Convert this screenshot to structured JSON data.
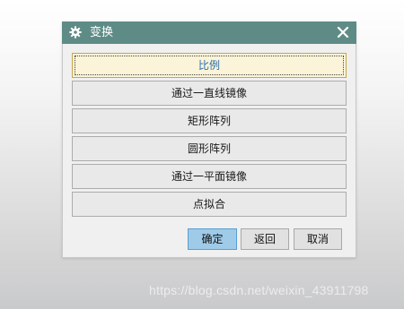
{
  "dialog": {
    "title": "变换",
    "options": [
      {
        "label": "比例",
        "selected": true
      },
      {
        "label": "通过一直线镜像",
        "selected": false
      },
      {
        "label": "矩形阵列",
        "selected": false
      },
      {
        "label": "圆形阵列",
        "selected": false
      },
      {
        "label": "通过一平面镜像",
        "selected": false
      },
      {
        "label": "点拟合",
        "selected": false
      }
    ],
    "buttons": {
      "ok": "确定",
      "back": "返回",
      "cancel": "取消"
    }
  },
  "watermark": "https://blog.csdn.net/weixin_43911798",
  "colors": {
    "titlebar": "#5f8b86",
    "selected_bg": "#fbf4d8",
    "selected_text": "#2a6fb0",
    "primary_button": "#9fcbe9"
  }
}
